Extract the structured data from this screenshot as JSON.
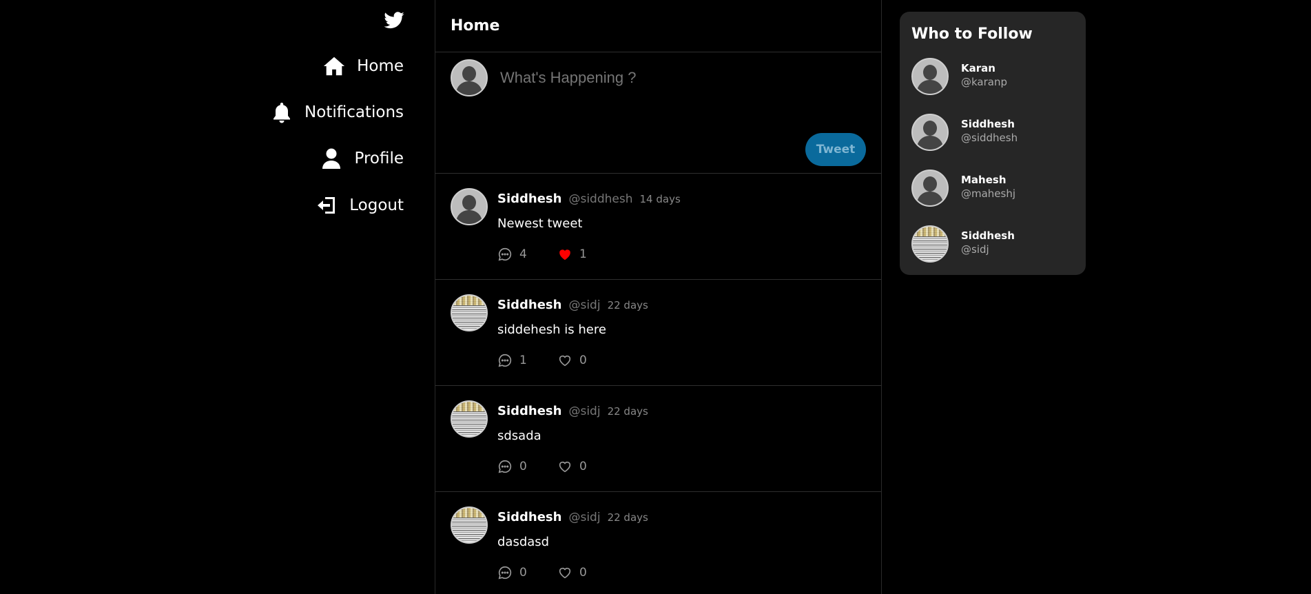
{
  "nav": {
    "logo_icon": "twitter-bird-icon",
    "items": [
      {
        "label": "Home",
        "icon": "home-icon"
      },
      {
        "label": "Notifications",
        "icon": "bell-icon"
      },
      {
        "label": "Profile",
        "icon": "user-icon"
      },
      {
        "label": "Logout",
        "icon": "logout-icon"
      }
    ]
  },
  "feed": {
    "title": "Home",
    "composer": {
      "placeholder": "What's Happening ?",
      "button_label": "Tweet"
    },
    "posts": [
      {
        "name": "Siddhesh",
        "handle": "@siddhesh",
        "time": "14 days",
        "text": "Newest tweet",
        "comments": "4",
        "likes": "1",
        "liked": true,
        "avatar": "default"
      },
      {
        "name": "Siddhesh",
        "handle": "@sidj",
        "time": "22 days",
        "text": "siddehesh is here",
        "comments": "1",
        "likes": "0",
        "liked": false,
        "avatar": "photo"
      },
      {
        "name": "Siddhesh",
        "handle": "@sidj",
        "time": "22 days",
        "text": "sdsada",
        "comments": "0",
        "likes": "0",
        "liked": false,
        "avatar": "photo"
      },
      {
        "name": "Siddhesh",
        "handle": "@sidj",
        "time": "22 days",
        "text": "dasdasd",
        "comments": "0",
        "likes": "0",
        "liked": false,
        "avatar": "photo"
      }
    ]
  },
  "who_to_follow": {
    "title": "Who to Follow",
    "users": [
      {
        "name": "Karan",
        "handle": "@karanp",
        "avatar": "default"
      },
      {
        "name": "Siddhesh",
        "handle": "@siddhesh",
        "avatar": "default"
      },
      {
        "name": "Mahesh",
        "handle": "@maheshj",
        "avatar": "default"
      },
      {
        "name": "Siddhesh",
        "handle": "@sidj",
        "avatar": "photo"
      }
    ]
  },
  "colors": {
    "background": "#000000",
    "panel": "#262626",
    "tweet_button": "#0a6a9c",
    "like_active": "#ff0000"
  }
}
